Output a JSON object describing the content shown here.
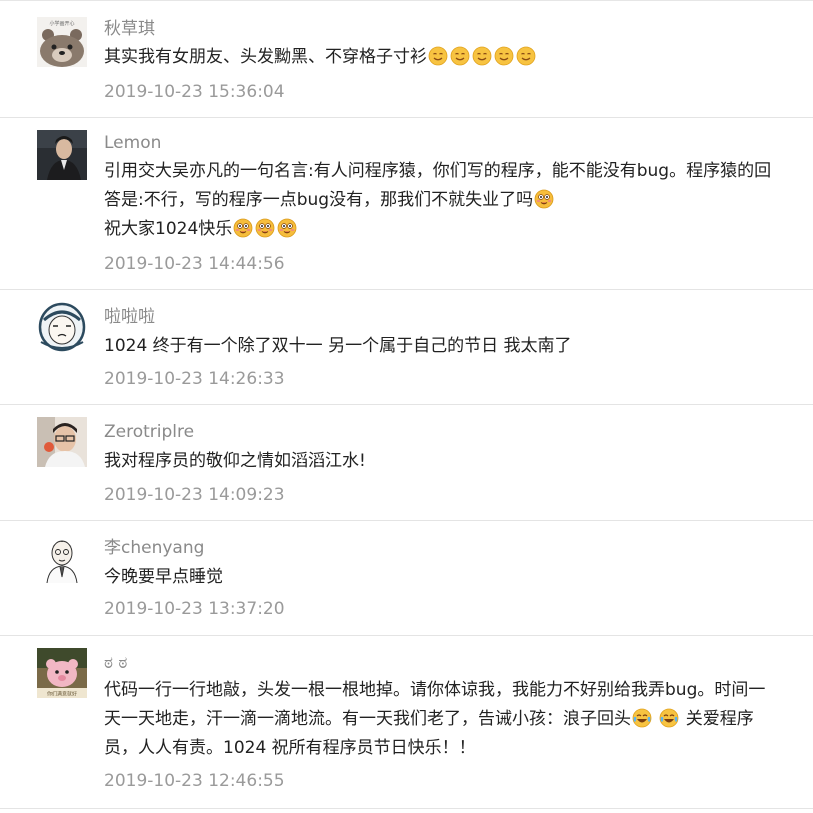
{
  "comments": [
    {
      "avatar": "bear-avatar",
      "user": "秋草琪",
      "lines": [
        {
          "text": "其实我有女朋友、头发黝黑、不穿格子寸衫",
          "emojis": [
            "smile-emoji",
            "smile-emoji",
            "smile-emoji",
            "smile-emoji",
            "smile-emoji"
          ]
        }
      ],
      "time": "2019-10-23 15:36:04"
    },
    {
      "avatar": "man-portrait-avatar",
      "user": "Lemon",
      "lines": [
        {
          "text": "引用交大吴亦凡的一句名言:有人问程序猿，你们写的程序，能不能没有bug。程序猿的回",
          "emojis": []
        },
        {
          "text": "答是:不行，写的程序一点bug没有，那我们不就失业了吗",
          "emojis": [
            "cheeky-emoji"
          ]
        },
        {
          "text": "祝大家1024快乐",
          "emojis": [
            "cheeky-emoji",
            "cheeky-emoji",
            "cheeky-emoji"
          ]
        }
      ],
      "time": "2019-10-23 14:44:56"
    },
    {
      "avatar": "cartoon-face-avatar",
      "user": "啦啦啦",
      "lines": [
        {
          "text": "1024 终于有一个除了双十一 另一个属于自己的节日 我太南了",
          "emojis": []
        }
      ],
      "time": "2019-10-23 14:26:33"
    },
    {
      "avatar": "selfie-avatar",
      "user": "Zerotriplre",
      "lines": [
        {
          "text": "我对程序员的敬仰之情如滔滔江水!",
          "emojis": []
        }
      ],
      "time": "2019-10-23 14:09:23"
    },
    {
      "avatar": "sketch-man-avatar",
      "user": "李chenyang",
      "lines": [
        {
          "text": "今晚要早点睡觉",
          "emojis": []
        }
      ],
      "time": "2019-10-23 13:37:20"
    },
    {
      "avatar": "pink-animal-avatar",
      "user": "ಠ ಠ",
      "lines": [
        {
          "text": "代码一行一行地敲，头发一根一根地掉。请你体谅我，我能力不好别给我弄bug。时间一",
          "emojis": []
        },
        {
          "text": "天一天地走，汗一滴一滴地流。有一天我们老了，告诫小孩：浪子回头",
          "emojis": [
            "laugh-cry-emoji",
            "laugh-cry-emoji"
          ],
          "after": " 关爱程序"
        },
        {
          "text": "员，人人有责。1024 祝所有程序员节日快乐！！",
          "emojis": []
        }
      ],
      "time": "2019-10-23 12:46:55"
    }
  ]
}
